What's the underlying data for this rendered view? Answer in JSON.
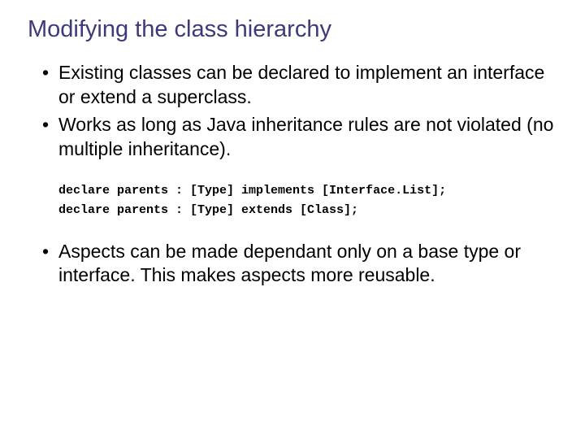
{
  "title": "Modifying the class hierarchy",
  "bullets_top": [
    "Existing classes can be declared to implement an interface or extend a superclass.",
    "Works as long as Java inheritance rules are not violated (no multiple inheritance)."
  ],
  "code_lines": [
    "declare parents : [Type] implements [Interface.List];",
    "declare parents : [Type] extends [Class];"
  ],
  "bullets_bottom": [
    "Aspects can be made dependant only on a base type or interface. This makes aspects more reusable."
  ]
}
